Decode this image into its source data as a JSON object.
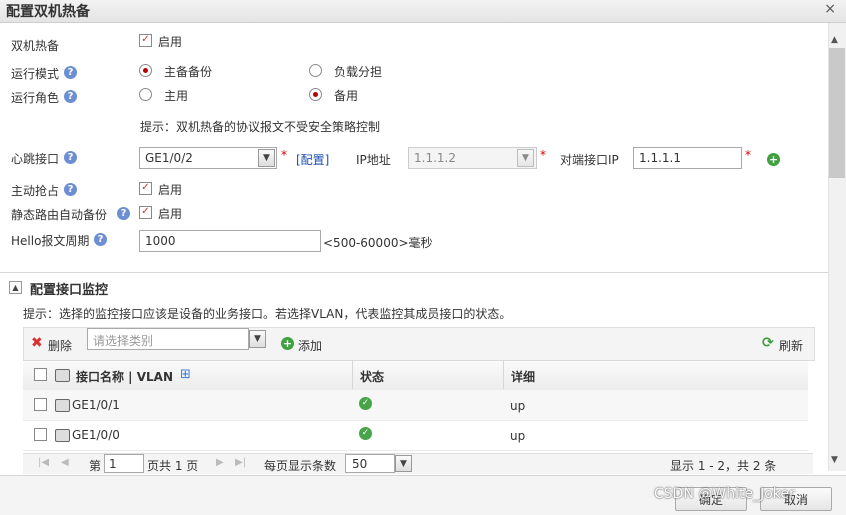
{
  "dialog": {
    "title": "配置双机热备",
    "close_symbol": "×"
  },
  "form": {
    "hot_standby": {
      "label": "双机热备",
      "checked": true,
      "option": "启用"
    },
    "run_mode": {
      "label": "运行模式",
      "options": [
        "主备备份",
        "负载分担"
      ],
      "selected": "主备备份"
    },
    "run_role": {
      "label": "运行角色",
      "options": [
        "主用",
        "备用"
      ],
      "selected": "备用"
    },
    "hint": "提示：双机热备的协议报文不受安全策略控制",
    "heartbeat": {
      "label": "心跳接口",
      "interface_value": "GE1/0/2",
      "configure_link": "[配置]",
      "ip_label": "IP地址",
      "ip_value": "1.1.1.2",
      "peer_label": "对端接口IP",
      "peer_value": "1.1.1.1"
    },
    "preempt": {
      "label": "主动抢占",
      "checked": true,
      "option": "启用"
    },
    "static_route_backup": {
      "label": "静态路由自动备份",
      "checked": true,
      "option": "启用"
    },
    "hello": {
      "label": "Hello报文周期",
      "value": "1000",
      "range": "<500-60000>毫秒"
    },
    "required_mark": "*"
  },
  "monitor": {
    "section_title": "配置接口监控",
    "hint": "提示：选择的监控接口应该是设备的业务接口。若选择VLAN，代表监控其成员接口的状态。",
    "toolbar": {
      "delete": "删除",
      "type_placeholder": "请选择类别",
      "add": "添加",
      "refresh": "刷新"
    },
    "columns": {
      "name": "接口名称 | VLAN",
      "status": "状态",
      "detail": "详细"
    },
    "rows": [
      {
        "name": "GE1/0/1",
        "status": "ok",
        "detail": "up"
      },
      {
        "name": "GE1/0/0",
        "status": "ok",
        "detail": "up"
      }
    ],
    "pager": {
      "page_prefix": "第",
      "page": "1",
      "page_suffix": "页共 1 页",
      "per_page_label": "每页显示条数",
      "per_page": "50",
      "summary": "显示 1 - 2，共 2 条"
    }
  },
  "footer": {
    "ok": "确定",
    "cancel": "取消"
  },
  "watermark": "CSDN @White_Joker"
}
